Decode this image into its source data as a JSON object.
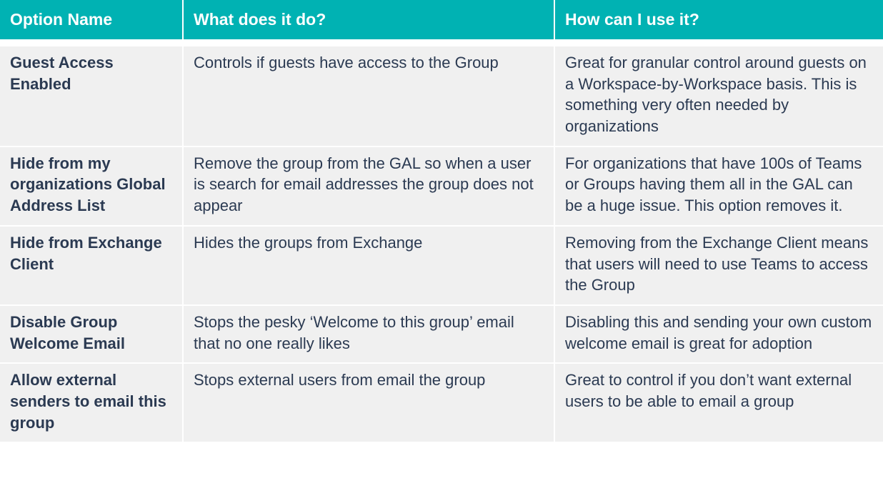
{
  "table": {
    "headers": {
      "name": "Option Name",
      "what": "What does it do?",
      "how": "How can I use it?"
    },
    "rows": [
      {
        "name": "Guest Access Enabled",
        "what": "Controls if guests have access to the Group",
        "how": "Great for granular control around guests on a Workspace-by-Workspace basis. This is something very often needed by organizations"
      },
      {
        "name": "Hide from my organizations Global Address List",
        "what": "Remove the group from the GAL so when a user is search for email addresses the group does not appear",
        "how": "For organizations that have 100s of Teams or Groups having them all in the GAL can be a huge issue. This option removes it."
      },
      {
        "name": "Hide from Exchange Client",
        "what": "Hides the groups from Exchange",
        "how": "Removing from the Exchange Client means that users will need to use Teams to access the Group"
      },
      {
        "name": "Disable Group Welcome Email",
        "what": "Stops the pesky ‘Welcome to this group’ email that no one really likes",
        "how": "Disabling this and sending your own custom welcome email is great for adoption"
      },
      {
        "name": "Allow external senders to email this group",
        "what": "Stops external users from email the group",
        "how": "Great to control if you don’t want external users to be able to email a group"
      }
    ]
  },
  "chart_data": {
    "type": "table",
    "title": "",
    "columns": [
      "Option Name",
      "What does it do?",
      "How can I use it?"
    ],
    "rows": [
      [
        "Guest Access Enabled",
        "Controls if guests have access to the Group",
        "Great for granular control around guests on a Workspace-by-Workspace basis. This is something very often needed by organizations"
      ],
      [
        "Hide from my organizations Global Address List",
        "Remove the group from the GAL so when a user is search for email addresses the group does not appear",
        "For organizations that have 100s of Teams or Groups having them all in the GAL can be a huge issue. This option removes it."
      ],
      [
        "Hide from Exchange Client",
        "Hides the groups from Exchange",
        "Removing from the Exchange Client means that users will need to use Teams to access the Group"
      ],
      [
        "Disable Group Welcome Email",
        "Stops the pesky ‘Welcome to this group’ email that no one really likes",
        "Disabling this and sending your own custom welcome email is great for adoption"
      ],
      [
        "Allow external senders to email this group",
        "Stops external users from email the group",
        "Great to control if you don’t want external users to be able to email a group"
      ]
    ]
  }
}
